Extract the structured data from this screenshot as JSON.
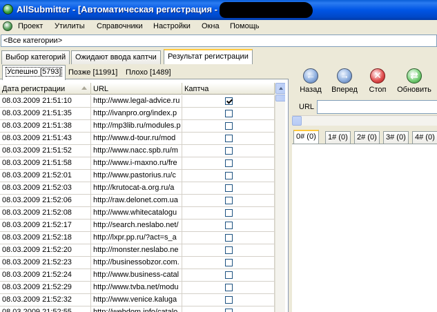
{
  "window": {
    "title": "AllSubmitter - [Автоматическая регистрация -",
    "icon": "globe-app-icon"
  },
  "menu": [
    "Проект",
    "Утилиты",
    "Справочники",
    "Настройки",
    "Окна",
    "Помощь"
  ],
  "category_select": {
    "value": "<Все категории>"
  },
  "main_tabs": [
    {
      "label": "Выбор категорий",
      "active": false
    },
    {
      "label": "Ожидают ввода каптчи",
      "active": false
    },
    {
      "label": "Результат регистрации",
      "active": true
    }
  ],
  "sub_tabs": [
    {
      "label": "Успешно [5793]",
      "active": true
    },
    {
      "label": "Позже [11991]",
      "active": false
    },
    {
      "label": "Плохо [1489]",
      "active": false
    }
  ],
  "table": {
    "columns": [
      "Дата регистрации",
      "URL",
      "Каптча"
    ],
    "rows": [
      {
        "date": "08.03.2009 21:51:10",
        "url": "http://www.legal-advice.ru",
        "captcha": true
      },
      {
        "date": "08.03.2009 21:51:35",
        "url": "http://ivanpro.org/index.p",
        "captcha": false
      },
      {
        "date": "08.03.2009 21:51:38",
        "url": "http://mp3lib.ru/modules.p",
        "captcha": false
      },
      {
        "date": "08.03.2009 21:51:43",
        "url": "http://www.d-tour.ru/mod",
        "captcha": false
      },
      {
        "date": "08.03.2009 21:51:52",
        "url": "http://www.nacc.spb.ru/m",
        "captcha": false
      },
      {
        "date": "08.03.2009 21:51:58",
        "url": "http://www.i-maxno.ru/fre",
        "captcha": false
      },
      {
        "date": "08.03.2009 21:52:01",
        "url": "http://www.pastorius.ru/c",
        "captcha": false
      },
      {
        "date": "08.03.2009 21:52:03",
        "url": "http://krutocat-a.org.ru/a",
        "captcha": false
      },
      {
        "date": "08.03.2009 21:52:06",
        "url": "http://raw.delonet.com.ua",
        "captcha": false
      },
      {
        "date": "08.03.2009 21:52:08",
        "url": "http://www.whitecatalogu",
        "captcha": false
      },
      {
        "date": "08.03.2009 21:52:17",
        "url": "http://search.neslabo.net/",
        "captcha": false
      },
      {
        "date": "08.03.2009 21:52:18",
        "url": "http://lxpr.pp.ru/?act=s_a",
        "captcha": false
      },
      {
        "date": "08.03.2009 21:52:20",
        "url": "http://monster.neslabo.ne",
        "captcha": false
      },
      {
        "date": "08.03.2009 21:52:23",
        "url": "http://businessobzor.com.",
        "captcha": false
      },
      {
        "date": "08.03.2009 21:52:24",
        "url": "http://www.business-catal",
        "captcha": false
      },
      {
        "date": "08.03.2009 21:52:29",
        "url": "http://www.tvba.net/modu",
        "captcha": false
      },
      {
        "date": "08.03.2009 21:52:32",
        "url": "http://www.venice.kaluga",
        "captcha": false
      },
      {
        "date": "08.03.2009 21:52:55",
        "url": "http://webdom.info/catalo",
        "captcha": false
      }
    ]
  },
  "browser": {
    "buttons": [
      {
        "label": "Назад",
        "icon": "back-arrow-icon"
      },
      {
        "label": "Вперед",
        "icon": "forward-arrow-icon"
      },
      {
        "label": "Стоп",
        "icon": "stop-icon"
      },
      {
        "label": "Обновить",
        "icon": "refresh-icon"
      }
    ],
    "url_label": "URL",
    "url_value": "",
    "tabs": [
      "0# (0)",
      "1# (0)",
      "2# (0)",
      "3# (0)",
      "4# (0)"
    ]
  }
}
